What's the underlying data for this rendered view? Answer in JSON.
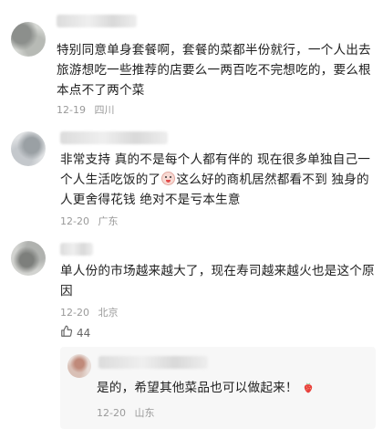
{
  "comments": [
    {
      "text": "特别同意单身套餐啊，套餐的菜都半份就行，一个人出去旅游想吃一些推荐的店要么一两百吃不完想吃的，要么根本点不了两个菜",
      "date": "12-19",
      "location": "四川"
    },
    {
      "text_before": "非常支持 真的不是每个人都有伴的 现在很多单独自己一个人生活吃饭的了",
      "text_after": "这么好的商机居然都看不到 独身的人更舍得花钱 绝对不是亏本生意",
      "date": "12-20",
      "location": "广东"
    },
    {
      "text": "单人份的市场越来越大了，现在寿司越来越火也是这个原因",
      "date": "12-20",
      "location": "北京",
      "likes": "44"
    }
  ],
  "reply": {
    "text": "是的，希望其他菜品也可以做起来！",
    "date": "12-20",
    "location": "山东"
  },
  "icons": {
    "like": "thumbs-up-icon",
    "emoji": "face-emoji-icon",
    "reply_emoji": "strawberry-icon"
  }
}
